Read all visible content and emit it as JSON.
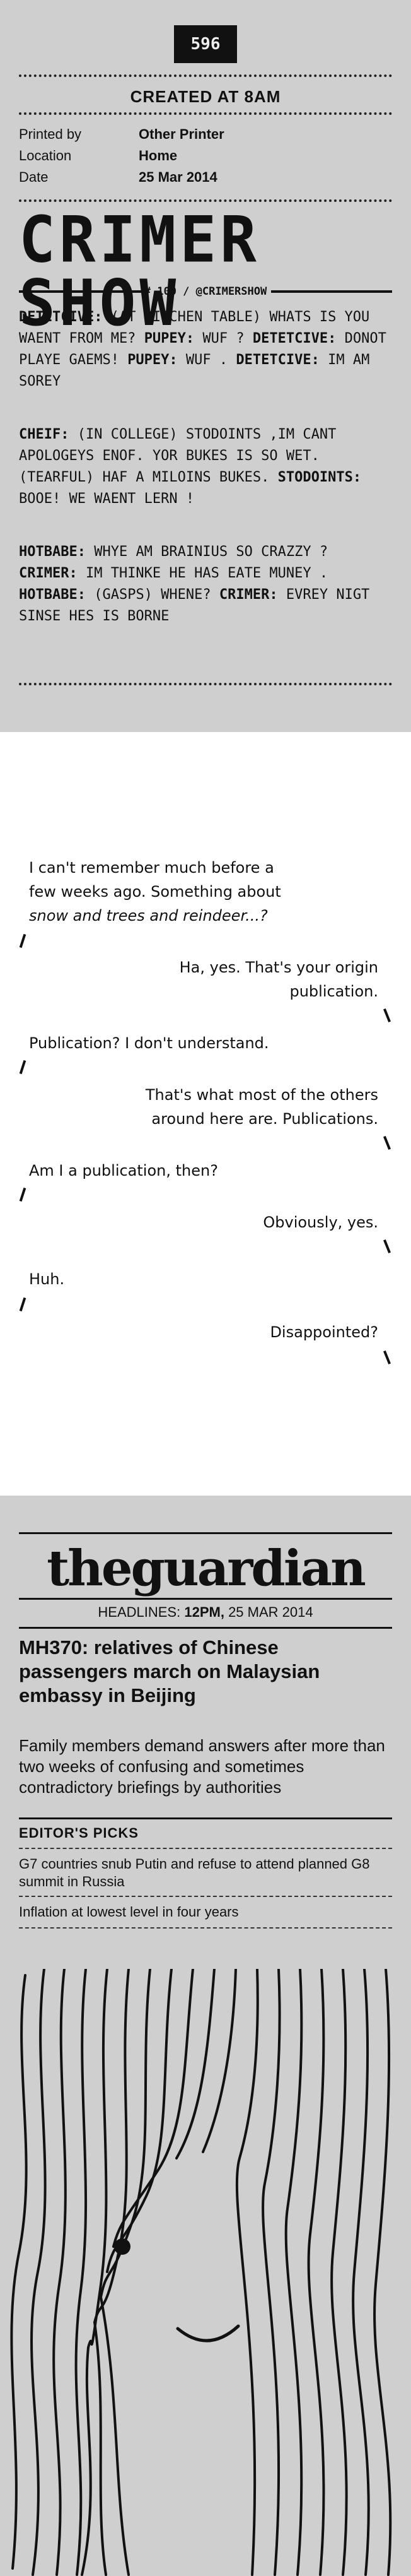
{
  "receipt_number": "596",
  "created": "CREATED AT 8AM",
  "meta": [
    {
      "label": "Printed by",
      "value": "Other Printer"
    },
    {
      "label": "Location",
      "value": "Home"
    },
    {
      "label": "Date",
      "value": "25 Mar 2014"
    }
  ],
  "crimer": {
    "title": "CRIMER SHOW",
    "subtitle": "# 100 / @CRIMERSHOW",
    "paragraphs": [
      [
        {
          "speaker": "DETETCIVE:",
          "text": " (AT KITCHEN TABLE) WHATS IS YOU WAENT FROM ME? "
        },
        {
          "speaker": "PUPEY:",
          "text": " WUF ? "
        },
        {
          "speaker": "DETETCIVE:",
          "text": " DONOT PLAYE GAEMS! "
        },
        {
          "speaker": "PUPEY:",
          "text": " WUF . "
        },
        {
          "speaker": "DETETCIVE:",
          "text": " IM AM SOREY"
        }
      ],
      [
        {
          "speaker": "CHEIF:",
          "text": " (IN COLLEGE) STODOINTS ,IM CANT APOLOGEYS ENOF. YOR BUKES IS SO WET. (TEARFUL) HAF A MILOINS BUKES. "
        },
        {
          "speaker": "STODOINTS:",
          "text": " BOOE! WE WAENT LERN !"
        }
      ],
      [
        {
          "speaker": "HOTBABE:",
          "text": " WHYE AM BRAINIUS SO CRAZZY ? "
        },
        {
          "speaker": "CRIMER:",
          "text": " IM THINKE HE HAS EATE MUNEY . "
        },
        {
          "speaker": "HOTBABE:",
          "text": " (GASPS) WHENE? "
        },
        {
          "speaker": "CRIMER:",
          "text": " EVREY NIGT SINSE HES IS BORNE"
        }
      ]
    ]
  },
  "dialogue": [
    {
      "side": "left",
      "lines": [
        "I can't remember much before a",
        "few weeks ago. Something about",
        "snow and trees and reindeer...?"
      ]
    },
    {
      "side": "right",
      "lines": [
        "Ha, yes. That's your origin",
        "publication."
      ]
    },
    {
      "side": "left",
      "lines": [
        "Publication? I don't understand."
      ]
    },
    {
      "side": "right",
      "lines": [
        "That's what most of the others",
        "around here are. Publications."
      ]
    },
    {
      "side": "left",
      "lines": [
        "Am I a publication, then?"
      ]
    },
    {
      "side": "right",
      "lines": [
        "Obviously, yes."
      ]
    },
    {
      "side": "left",
      "lines": [
        "Huh."
      ]
    },
    {
      "side": "right",
      "lines": [
        "Disappointed?"
      ]
    }
  ],
  "guardian": {
    "logo": "theguardian",
    "headlines_label": "HEADLINES:",
    "headlines_time": "12PM,",
    "headlines_date": "25 MAR 2014",
    "story_title": "MH370: relatives of Chinese passengers march on Malaysian embassy in Beijing",
    "story_desc": "Family members demand answers after more than two weeks of confusing and sometimes contradictory briefings by authorities",
    "picks_label": "EDITOR'S PICKS",
    "picks": [
      "G7 countries snub Putin and refuse to attend planned G8 summit in Russia",
      "Inflation at lowest level in four years"
    ]
  },
  "colors": {
    "paper": "#cfcfcf",
    "ink": "#111111",
    "white_panel": "#ffffff"
  },
  "icons": [
    "hair-face-drawing"
  ]
}
